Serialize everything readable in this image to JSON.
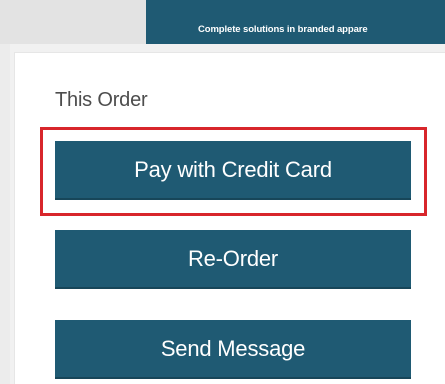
{
  "header": {
    "banner_text": "Complete solutions in branded appare"
  },
  "order_section": {
    "title": "This Order",
    "buttons": {
      "pay_credit_card": "Pay with Credit Card",
      "reorder": "Re-Order",
      "send_message": "Send Message"
    }
  },
  "colors": {
    "button_bg": "#1f5a73",
    "highlight_border": "#d8262b",
    "title_text": "#4d4d4d"
  }
}
